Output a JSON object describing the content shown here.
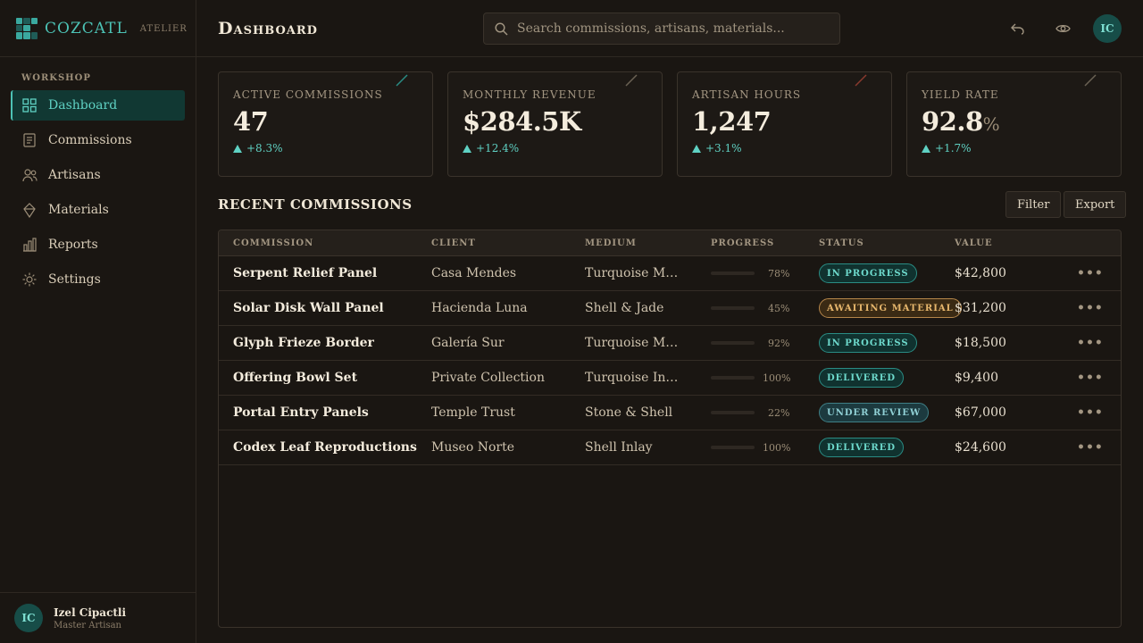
{
  "brand": {
    "name": "COZCATL",
    "sub": "ATELIER"
  },
  "sidebar": {
    "section": "WORKSHOP",
    "items": [
      {
        "label": "Dashboard",
        "icon": "grid-icon",
        "active": true
      },
      {
        "label": "Commissions",
        "icon": "document-icon"
      },
      {
        "label": "Artisans",
        "icon": "people-icon"
      },
      {
        "label": "Materials",
        "icon": "gem-icon"
      },
      {
        "label": "Reports",
        "icon": "bar-chart-icon"
      },
      {
        "label": "Settings",
        "icon": "gear-icon"
      }
    ]
  },
  "user": {
    "initials": "IC",
    "name": "Izel Cipactli",
    "role": "Master Artisan"
  },
  "header": {
    "title": "Dashboard",
    "search_placeholder": "Search commissions, artisans, materials...",
    "avatar_initials": "IC"
  },
  "kpis": [
    {
      "label": "ACTIVE COMMISSIONS",
      "value": "47",
      "unit": "",
      "delta": "+8.3%",
      "accent": "#2a8c84"
    },
    {
      "label": "MONTHLY REVENUE",
      "value": "$284.5K",
      "unit": "",
      "delta": "+12.4%",
      "accent": "#6b6255"
    },
    {
      "label": "ARTISAN HOURS",
      "value": "1,247",
      "unit": "",
      "delta": "+3.1%",
      "accent": "#8a3a2e"
    },
    {
      "label": "YIELD RATE",
      "value": "92.8",
      "unit": "%",
      "delta": "+1.7%",
      "accent": "#6b6255"
    }
  ],
  "section": {
    "title": "RECENT COMMISSIONS",
    "filter_label": "Filter",
    "export_label": "Export"
  },
  "table": {
    "headers": [
      "COMMISSION",
      "CLIENT",
      "MEDIUM",
      "PROGRESS",
      "STATUS",
      "VALUE"
    ],
    "rows": [
      {
        "commission": "Serpent Relief Panel",
        "client": "Casa Mendes",
        "medium": "Turquoise Mo...",
        "progress": 78,
        "progress_label": "78%",
        "status": "IN PROGRESS",
        "status_type": "inprogress",
        "value": "$42,800"
      },
      {
        "commission": "Solar Disk Wall Panel",
        "client": "Hacienda Luna",
        "medium": "Shell & Jade",
        "progress": 45,
        "progress_label": "45%",
        "status": "AWAITING MATERIAL",
        "status_type": "awaiting",
        "value": "$31,200"
      },
      {
        "commission": "Glyph Frieze Border",
        "client": "Galería Sur",
        "medium": "Turquoise Mo...",
        "progress": 92,
        "progress_label": "92%",
        "status": "IN PROGRESS",
        "status_type": "inprogress",
        "value": "$18,500"
      },
      {
        "commission": "Offering Bowl Set",
        "client": "Private Collection",
        "medium": "Turquoise Inlay",
        "progress": 100,
        "progress_label": "100%",
        "status": "DELIVERED",
        "status_type": "delivered",
        "value": "$9,400"
      },
      {
        "commission": "Portal Entry Panels",
        "client": "Temple Trust",
        "medium": "Stone & Shell",
        "progress": 22,
        "progress_label": "22%",
        "status": "UNDER REVIEW",
        "status_type": "review",
        "value": "$67,000"
      },
      {
        "commission": "Codex Leaf Reproductions",
        "client": "Museo Norte",
        "medium": "Shell Inlay",
        "progress": 100,
        "progress_label": "100%",
        "status": "DELIVERED",
        "status_type": "delivered",
        "value": "$24,600"
      }
    ],
    "more_label": "•••"
  }
}
